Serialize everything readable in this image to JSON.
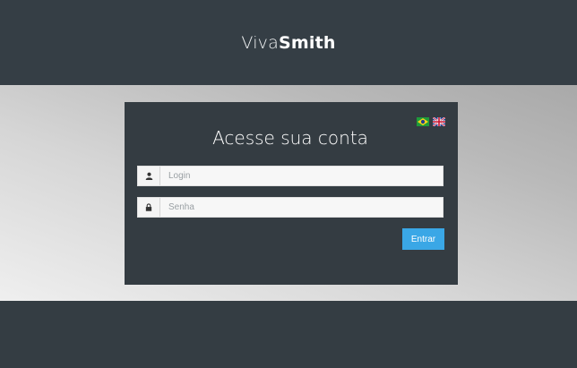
{
  "header": {
    "logo_light": "Viva",
    "logo_bold": "Smith"
  },
  "login": {
    "title": "Acesse sua conta",
    "languages": [
      "pt-BR",
      "en-GB"
    ],
    "username_placeholder": "Login",
    "password_placeholder": "Senha",
    "submit_label": "Entrar"
  },
  "colors": {
    "header_bg": "#353e45",
    "card_bg": "#343c42",
    "button_bg": "#3aa7e6"
  }
}
